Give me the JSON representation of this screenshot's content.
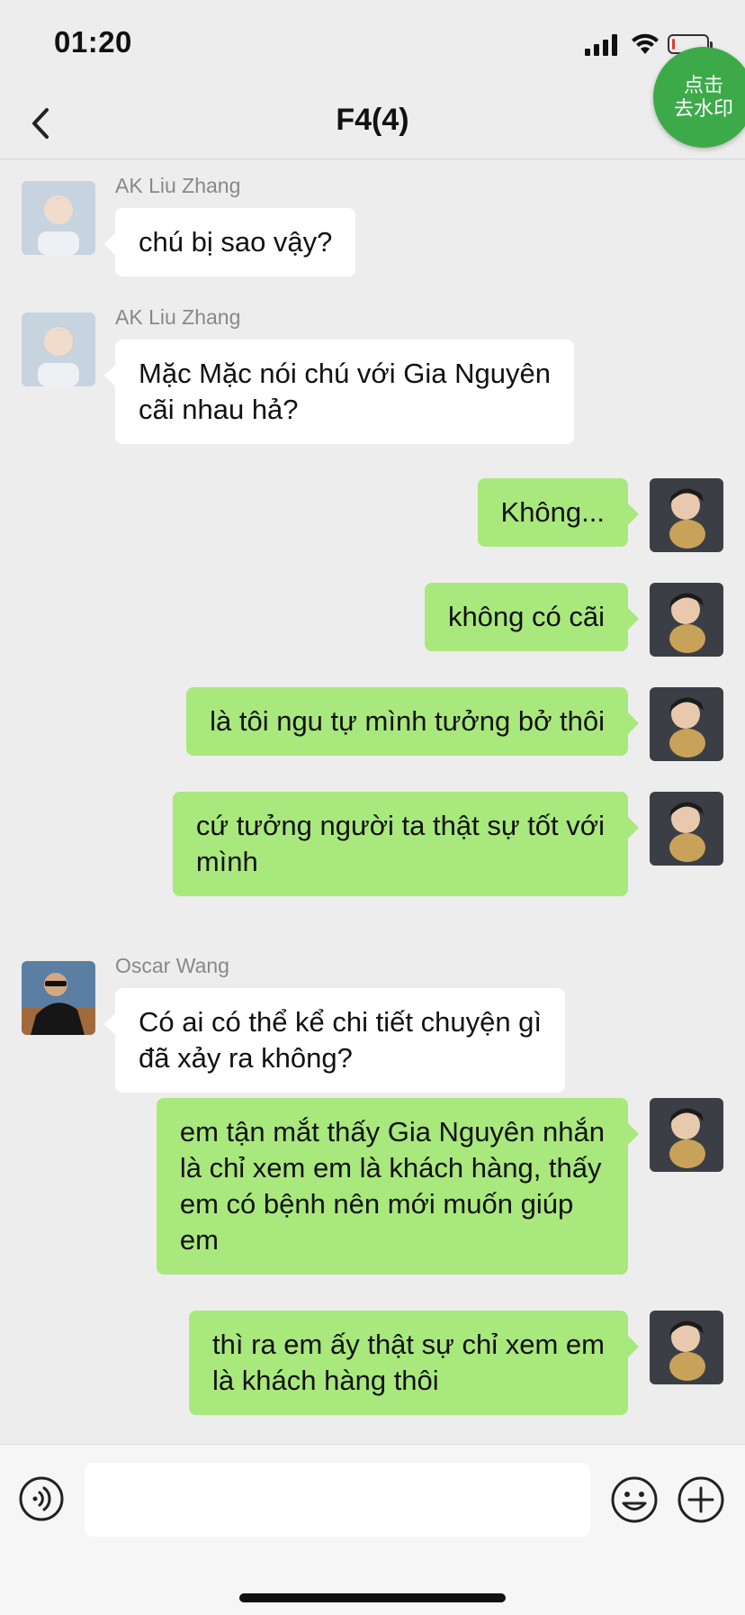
{
  "status_bar": {
    "time": "01:20",
    "battery_level": 0.08
  },
  "header": {
    "title": "F4(4)",
    "back_icon": "chevron-left-icon"
  },
  "watermark_button": {
    "line1": "点击",
    "line2": "去水印",
    "color": "#3daa4a"
  },
  "messages": [
    {
      "side": "left",
      "sender": "AK Liu Zhang",
      "text": "chú bị sao vậy?",
      "avatar": "ak-avatar"
    },
    {
      "side": "left",
      "sender": "AK Liu Zhang",
      "text": "Mặc Mặc nói chú với Gia Nguyên\ncãi nhau hả?",
      "avatar": "ak-avatar"
    },
    {
      "side": "right",
      "text": "Không...",
      "avatar": "self-avatar"
    },
    {
      "side": "right",
      "text": "không có cãi",
      "avatar": "self-avatar"
    },
    {
      "side": "right",
      "text": "là tôi ngu tự mình tưởng bở thôi",
      "avatar": "self-avatar"
    },
    {
      "side": "right",
      "text": "cứ tưởng người ta thật sự tốt với\nmình",
      "avatar": "self-avatar"
    },
    {
      "side": "left",
      "sender": "Oscar Wang",
      "text": "Có ai có thể kể chi tiết chuyện gì\nđã xảy ra không?",
      "avatar": "oscar-avatar"
    },
    {
      "side": "right",
      "text": "em tận mắt thấy Gia Nguyên nhắn\nlà chỉ xem em là khách hàng, thấy\nem có bệnh nên mới muốn giúp\nem",
      "avatar": "self-avatar"
    },
    {
      "side": "right",
      "text": "thì ra em ấy thật sự chỉ xem em\nlà khách hàng thôi",
      "avatar": "self-avatar"
    }
  ],
  "input_bar": {
    "voice_icon": "voice-icon",
    "emoji_icon": "emoji-icon",
    "plus_icon": "plus-icon",
    "input_value": ""
  },
  "colors": {
    "background": "#ededed",
    "self_bubble": "#a9e87d",
    "other_bubble": "#ffffff"
  }
}
